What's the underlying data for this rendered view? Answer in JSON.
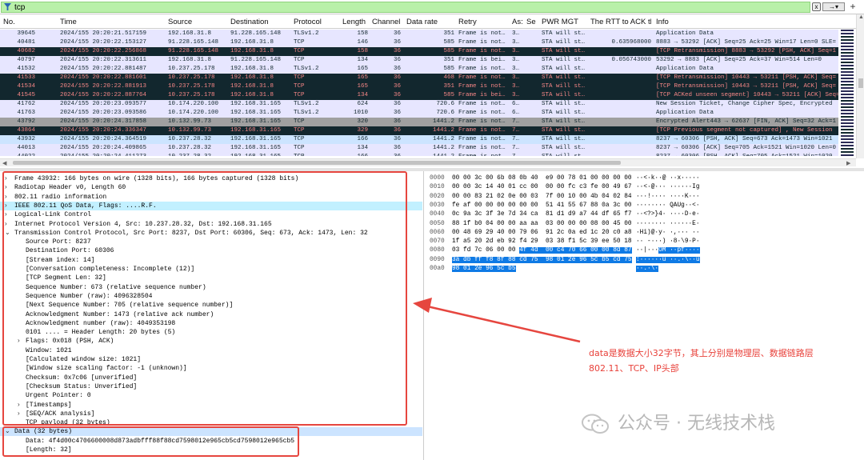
{
  "filter": {
    "value": "tcp",
    "clear": "x",
    "apply_arrow": "→▾",
    "add": "+"
  },
  "columns": [
    "No.",
    "Time",
    "Source",
    "Destination",
    "Protocol",
    "Length",
    "Channel",
    "Data rate",
    "Retry",
    "As:",
    "Se",
    "PWR MGT",
    "The RTT to ACK th",
    "Info"
  ],
  "packets": [
    {
      "no": "39645",
      "time": "2024/155 20:20:21.517159",
      "src": "192.168.31.8",
      "dst": "91.228.165.148",
      "proto": "TLSv1.2",
      "len": "158",
      "ch": "36",
      "rate": "351",
      "retry": "Frame is not…",
      "as": "3…",
      "pwr": "STA will st…",
      "rtt": "",
      "info": "Application Data",
      "bg": "#e7e6ff",
      "fg": "#12272e"
    },
    {
      "no": "40481",
      "time": "2024/155 20:20:22.153127",
      "src": "91.228.165.148",
      "dst": "192.168.31.8",
      "proto": "TCP",
      "len": "146",
      "ch": "36",
      "rate": "585",
      "retry": "Frame is not…",
      "as": "3…",
      "pwr": "STA will st…",
      "rtt": "0.635968000",
      "info": "8883 → 53292 [ACK] Seq=25 Ack=25 Win=17 Len=0 SLE=",
      "bg": "#e7e6ff",
      "fg": "#12272e"
    },
    {
      "no": "40682",
      "time": "2024/155 20:20:22.256868",
      "src": "91.228.165.148",
      "dst": "192.168.31.8",
      "proto": "TCP",
      "len": "158",
      "ch": "36",
      "rate": "585",
      "retry": "Frame is not…",
      "as": "3…",
      "pwr": "STA will st…",
      "rtt": "",
      "info": "[TCP Retransmission] 8883 → 53292 [PSH, ACK] Seq=1",
      "bg": "#12272e",
      "fg": "#f78787"
    },
    {
      "no": "40797",
      "time": "2024/155 20:20:22.313611",
      "src": "192.168.31.8",
      "dst": "91.228.165.148",
      "proto": "TCP",
      "len": "134",
      "ch": "36",
      "rate": "351",
      "retry": "Frame is bei…",
      "as": "3…",
      "pwr": "STA will st…",
      "rtt": "0.056743000",
      "info": "53292 → 8883 [ACK] Seq=25 Ack=37 Win=514 Len=0",
      "bg": "#e7e6ff",
      "fg": "#12272e"
    },
    {
      "no": "41532",
      "time": "2024/155 20:20:22.881487",
      "src": "10.237.25.178",
      "dst": "192.168.31.8",
      "proto": "TLSv1.2",
      "len": "165",
      "ch": "36",
      "rate": "585",
      "retry": "Frame is not…",
      "as": "3…",
      "pwr": "STA will st…",
      "rtt": "",
      "info": "Application Data",
      "bg": "#e7e6ff",
      "fg": "#12272e"
    },
    {
      "no": "41533",
      "time": "2024/155 20:20:22.881601",
      "src": "10.237.25.178",
      "dst": "192.168.31.8",
      "proto": "TCP",
      "len": "165",
      "ch": "36",
      "rate": "468",
      "retry": "Frame is not…",
      "as": "3…",
      "pwr": "STA will st…",
      "rtt": "",
      "info": "[TCP Retransmission] 10443 → 53211 [PSH, ACK] Seq=",
      "bg": "#12272e",
      "fg": "#f78787"
    },
    {
      "no": "41534",
      "time": "2024/155 20:20:22.881913",
      "src": "10.237.25.178",
      "dst": "192.168.31.8",
      "proto": "TCP",
      "len": "165",
      "ch": "36",
      "rate": "351",
      "retry": "Frame is not…",
      "as": "3…",
      "pwr": "STA will st…",
      "rtt": "",
      "info": "[TCP Retransmission] 10443 → 53211 [PSH, ACK] Seq=",
      "bg": "#12272e",
      "fg": "#f78787"
    },
    {
      "no": "41545",
      "time": "2024/155 20:20:22.887764",
      "src": "10.237.25.178",
      "dst": "192.168.31.8",
      "proto": "TCP",
      "len": "134",
      "ch": "36",
      "rate": "585",
      "retry": "Frame is bei…",
      "as": "3…",
      "pwr": "STA will st…",
      "rtt": "",
      "info": "[TCP ACKed unseen segment] 10443 → 53211 [ACK] Seq=",
      "bg": "#12272e",
      "fg": "#f78787"
    },
    {
      "no": "41762",
      "time": "2024/155 20:20:23.093577",
      "src": "10.174.220.100",
      "dst": "192.168.31.165",
      "proto": "TLSv1.2",
      "len": "624",
      "ch": "36",
      "rate": "720.6",
      "retry": "Frame is not…",
      "as": "6…",
      "pwr": "STA will st…",
      "rtt": "",
      "info": "New Session Ticket, Change Cipher Spec, Encrypted",
      "bg": "#e7e6ff",
      "fg": "#12272e"
    },
    {
      "no": "41763",
      "time": "2024/155 20:20:23.093586",
      "src": "10.174.220.100",
      "dst": "192.168.31.165",
      "proto": "TLSv1.2",
      "len": "1010",
      "ch": "36",
      "rate": "720.6",
      "retry": "Frame is not…",
      "as": "6…",
      "pwr": "STA will st…",
      "rtt": "",
      "info": "Application Data",
      "bg": "#e7e6ff",
      "fg": "#12272e"
    },
    {
      "no": "43792",
      "time": "2024/155 20:20:24.317858",
      "src": "10.132.99.73",
      "dst": "192.168.31.165",
      "proto": "TCP",
      "len": "320",
      "ch": "36",
      "rate": "1441.2",
      "retry": "Frame is not…",
      "as": "7…",
      "pwr": "STA will st…",
      "rtt": "",
      "info": "Encrypted Alert443 → 62637 [FIN, ACK] Seq=32 Ack=1",
      "bg": "#a0a0a0",
      "fg": "#12272e"
    },
    {
      "no": "43864",
      "time": "2024/155 20:20:24.336347",
      "src": "10.132.99.73",
      "dst": "192.168.31.165",
      "proto": "TCP",
      "len": "329",
      "ch": "36",
      "rate": "1441.2",
      "retry": "Frame is not…",
      "as": "7…",
      "pwr": "STA will st…",
      "rtt": "",
      "info": "[TCP Previous segment not captured] , New Session",
      "bg": "#12272e",
      "fg": "#f78787"
    },
    {
      "no": "43932",
      "time": "2024/155 20:20:24.364519",
      "src": "10.237.28.32",
      "dst": "192.168.31.165",
      "proto": "TCP",
      "len": "166",
      "ch": "36",
      "rate": "1441.2",
      "retry": "Frame is not…",
      "as": "7…",
      "pwr": "STA will st…",
      "rtt": "",
      "info": "8237 → 60306 [PSH, ACK] Seq=673 Ack=1473 Win=1021",
      "bg": "#cce4ff",
      "fg": "#12272e"
    },
    {
      "no": "44013",
      "time": "2024/155 20:20:24.409865",
      "src": "10.237.28.32",
      "dst": "192.168.31.165",
      "proto": "TCP",
      "len": "134",
      "ch": "36",
      "rate": "1441.2",
      "retry": "Frame is not…",
      "as": "7…",
      "pwr": "STA will st…",
      "rtt": "",
      "info": "8237 → 60306 [ACK] Seq=705 Ack=1521 Win=1020 Len=0",
      "bg": "#e7e6ff",
      "fg": "#12272e"
    },
    {
      "no": "44022",
      "time": "2024/155 20:20:24.411273",
      "src": "10.237.28.32",
      "dst": "192.168.31.165",
      "proto": "TCP",
      "len": "166",
      "ch": "36",
      "rate": "1441.2",
      "retry": "Frame is not…",
      "as": "7…",
      "pwr": "STA will st…",
      "rtt": "",
      "info": "8237 → 60306 [PSH, ACK] Seq=705 Ack=1521 Win=1020",
      "bg": "#e7e6ff",
      "fg": "#12272e"
    }
  ],
  "details": [
    {
      "text": "Frame 43932: 166 bytes on wire (1328 bits), 166 bytes captured (1328 bits)",
      "indent": 0,
      "toggle": "›",
      "hl": false
    },
    {
      "text": "Radiotap Header v0, Length 60",
      "indent": 0,
      "toggle": "›",
      "hl": false
    },
    {
      "text": "802.11 radio information",
      "indent": 0,
      "toggle": "›",
      "hl": false
    },
    {
      "text": "IEEE 802.11 QoS Data, Flags: ....R.F.",
      "indent": 0,
      "toggle": "›",
      "hl": true
    },
    {
      "text": "Logical-Link Control",
      "indent": 0,
      "toggle": "›",
      "hl": false
    },
    {
      "text": "Internet Protocol Version 4, Src: 10.237.28.32, Dst: 192.168.31.165",
      "indent": 0,
      "toggle": "›",
      "hl": false
    },
    {
      "text": "Transmission Control Protocol, Src Port: 8237, Dst Port: 60306, Seq: 673, Ack: 1473, Len: 32",
      "indent": 0,
      "toggle": "⌄",
      "hl": false
    },
    {
      "text": "Source Port: 8237",
      "indent": 2,
      "toggle": "",
      "hl": false
    },
    {
      "text": "Destination Port: 60306",
      "indent": 2,
      "toggle": "",
      "hl": false
    },
    {
      "text": "[Stream index: 14]",
      "indent": 2,
      "toggle": "",
      "hl": false
    },
    {
      "text": "[Conversation completeness: Incomplete (12)]",
      "indent": 2,
      "toggle": "",
      "hl": false
    },
    {
      "text": "[TCP Segment Len: 32]",
      "indent": 2,
      "toggle": "",
      "hl": false
    },
    {
      "text": "Sequence Number: 673    (relative sequence number)",
      "indent": 2,
      "toggle": "",
      "hl": false
    },
    {
      "text": "Sequence Number (raw): 4096328504",
      "indent": 2,
      "toggle": "",
      "hl": false
    },
    {
      "text": "[Next Sequence Number: 705    (relative sequence number)]",
      "indent": 2,
      "toggle": "",
      "hl": false
    },
    {
      "text": "Acknowledgment Number: 1473    (relative ack number)",
      "indent": 2,
      "toggle": "",
      "hl": false
    },
    {
      "text": "Acknowledgment number (raw): 4049353198",
      "indent": 2,
      "toggle": "",
      "hl": false
    },
    {
      "text": "0101 .... = Header Length: 20 bytes (5)",
      "indent": 2,
      "toggle": "",
      "hl": false
    },
    {
      "text": "Flags: 0x018 (PSH, ACK)",
      "indent": 2,
      "toggle": "›",
      "hl": false
    },
    {
      "text": "Window: 1021",
      "indent": 2,
      "toggle": "",
      "hl": false
    },
    {
      "text": "[Calculated window size: 1021]",
      "indent": 2,
      "toggle": "",
      "hl": false
    },
    {
      "text": "[Window size scaling factor: -1 (unknown)]",
      "indent": 2,
      "toggle": "",
      "hl": false
    },
    {
      "text": "Checksum: 0x7c06 [unverified]",
      "indent": 2,
      "toggle": "",
      "hl": false
    },
    {
      "text": "[Checksum Status: Unverified]",
      "indent": 2,
      "toggle": "",
      "hl": false
    },
    {
      "text": "Urgent Pointer: 0",
      "indent": 2,
      "toggle": "",
      "hl": false
    },
    {
      "text": "[Timestamps]",
      "indent": 2,
      "toggle": "›",
      "hl": false
    },
    {
      "text": "[SEQ/ACK analysis]",
      "indent": 2,
      "toggle": "›",
      "hl": false
    },
    {
      "text": "TCP payload (32 bytes)",
      "indent": 2,
      "toggle": "",
      "hl": false
    },
    {
      "text": "Data (32 bytes)",
      "indent": 0,
      "toggle": "⌄",
      "hl": false,
      "sel": true
    },
    {
      "text": "Data: 4f4d00c4706600008d873adbfff88f88cd7598012e965cb5cd7598012e965cb5",
      "indent": 2,
      "toggle": "",
      "hl": false
    },
    {
      "text": "[Length: 32]",
      "indent": 2,
      "toggle": "",
      "hl": false
    }
  ],
  "bytes": [
    {
      "off": "0000",
      "hex": "00 00 3c 00 6b 08 0b 40  e9 00 78 01 00 00 00 00",
      "ascii": "··<·k··@ ··x·····",
      "sel_from": -1
    },
    {
      "off": "0010",
      "hex": "00 00 3c 14 40 01 cc 00  00 00 fc c3 fe 00 49 67",
      "ascii": "··<·@··· ······Ig",
      "sel_from": -1
    },
    {
      "off": "0020",
      "hex": "00 00 83 21 02 0e 00 03  7f 00 10 00 4b 04 02 84",
      "ascii": "···!···· ····K···",
      "sel_from": -1
    },
    {
      "off": "0030",
      "hex": "fe af 00 00 00 00 00 00  51 41 55 67 88 0a 3c 00",
      "ascii": "········ QAUg··<·",
      "sel_from": -1
    },
    {
      "off": "0040",
      "hex": "0c 9a 3c 3f 3e 7d 34 ca  81 d1 d9 a7 44 df 65 f7",
      "ascii": "··<?>}4· ····D·e·",
      "sel_from": -1
    },
    {
      "off": "0050",
      "hex": "88 1f b0 04 00 00 aa aa  03 00 00 00 08 00 45 00",
      "ascii": "········ ······E·",
      "sel_from": -1
    },
    {
      "off": "0060",
      "hex": "00 48 69 29 40 00 79 06  91 2c 0a ed 1c 20 c0 a8",
      "ascii": "·Hi)@·y· ·,··· ··",
      "sel_from": -1
    },
    {
      "off": "0070",
      "hex": "1f a5 20 2d eb 92 f4 29  03 38 f1 5c 39 ee 50 18",
      "ascii": "·· -···) ·8·\\9·P·",
      "sel_from": -1
    },
    {
      "off": "0080",
      "hex": "03 fd 7c 06 00 00 ",
      "hexsel": "4f 4d  00 c4 70 66 00 00 8d 87",
      "ascii": "··|···",
      "asciisel": "OM ··pf····",
      "sel_from": 6
    },
    {
      "off": "0090",
      "hex": "",
      "hexsel": "3a db ff f8 8f 88 cd 75  98 01 2e 96 5c b5 cd 75",
      "ascii": "",
      "asciisel": ":······u ··.·\\··u",
      "sel_from": 0
    },
    {
      "off": "00a0",
      "hex": "",
      "hexsel": "98 01 2e 96 5c b5",
      "ascii": "",
      "asciisel": "··.·\\·",
      "sel_from": 0
    }
  ],
  "annotation": "data是数据大小32字节，其上分别是物理层、数据链路层802.11、TCP、IP头部",
  "watermark": "公众号 · 无线技术栈",
  "colors": {
    "tcp_bad_bg": "#12272e",
    "tcp_bad_fg": "#f78787",
    "normal_bg": "#e7e6ff",
    "selected_bg": "#cce4ff",
    "accent_red": "#e6463f"
  }
}
